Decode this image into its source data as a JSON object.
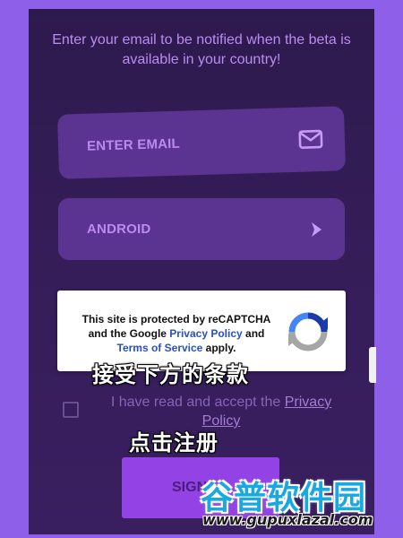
{
  "intro": {
    "text": "Enter your email to be notified when the beta is available in your country!"
  },
  "email": {
    "placeholder": "ENTER EMAIL",
    "icon": "mail-icon"
  },
  "platform": {
    "value": "ANDROID",
    "icon": "chevron-right-icon"
  },
  "recaptcha": {
    "line1": "This site is protected by reCAPTCHA",
    "line2_pre": "and the Google ",
    "privacy_link": "Privacy Policy",
    "line2_post": " and",
    "terms_link": "Terms of Service",
    "line3_post": " apply."
  },
  "overlay": {
    "accept_terms_cn": "接受下方的条款",
    "click_signup_cn": "点击注册"
  },
  "consent": {
    "text_pre": "I have read and accept the ",
    "policy_link": "Privacy Policy"
  },
  "signup": {
    "label": "SIGN"
  },
  "watermark": {
    "logo_text": "谷普软件园",
    "url": "www.gupuxlazal.com"
  },
  "colors": {
    "background": "#8e5fe8",
    "panel": "#341d57",
    "field": "#5b3390",
    "accent_text": "#b98cf2",
    "button": "#9342e6"
  }
}
